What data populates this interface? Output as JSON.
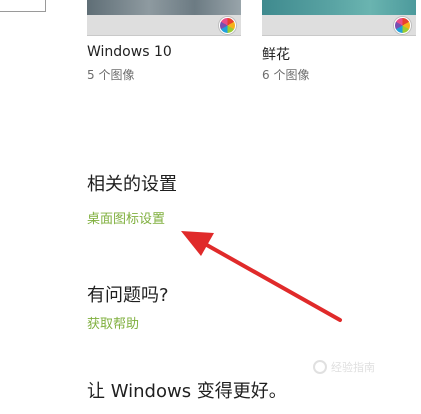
{
  "themes": [
    {
      "name": "Windows 10",
      "count": "5 个图像"
    },
    {
      "name": "鲜花",
      "count": "6 个图像"
    }
  ],
  "related": {
    "heading": "相关的设置",
    "desktop_icons_link": "桌面图标设置"
  },
  "help": {
    "heading": "有问题吗?",
    "get_help_link": "获取帮助"
  },
  "improve": {
    "heading": "让 Windows 变得更好。"
  },
  "watermark": {
    "text": "经验指南"
  },
  "colors": {
    "link": "#80b03f",
    "annotation_arrow": "#e02a2a"
  },
  "icons": [
    "search-icon",
    "color-palette-icon",
    "red-arrow-annotation"
  ]
}
